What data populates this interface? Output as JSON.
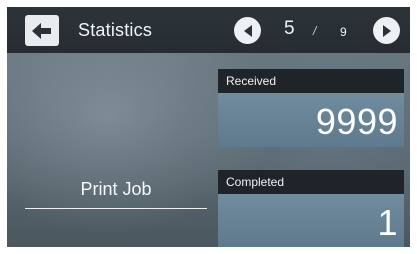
{
  "header": {
    "title": "Statistics",
    "back_icon": "arrow-left-icon",
    "prev_icon": "triangle-left-icon",
    "next_icon": "triangle-right-icon"
  },
  "pager": {
    "current": "5",
    "separator": "/",
    "total": "9"
  },
  "section": {
    "label": "Print Job"
  },
  "stats": {
    "received": {
      "label": "Received",
      "value": "9999"
    },
    "completed": {
      "label": "Completed",
      "value": "1"
    }
  },
  "colors": {
    "topbar": "#2a3136",
    "card_header": "#1f2428",
    "card_body": "#6f899b",
    "button_face": "#e9ecef"
  }
}
